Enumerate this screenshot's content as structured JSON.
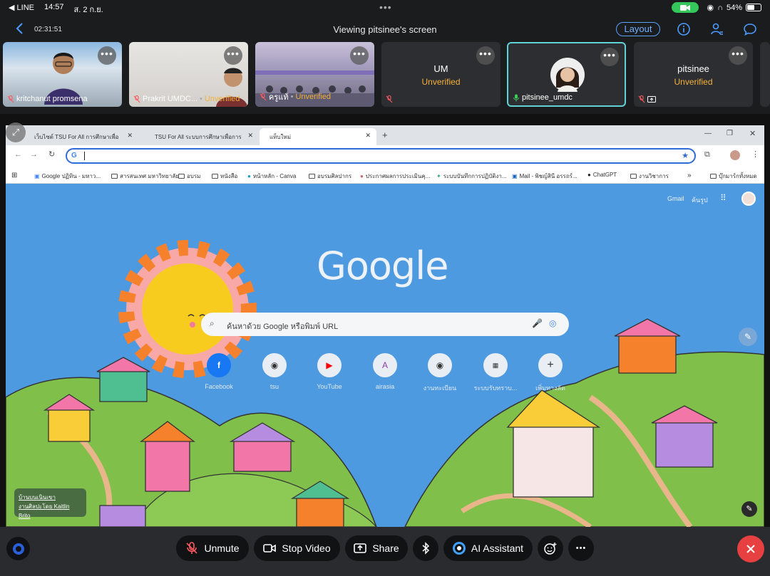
{
  "status": {
    "app": "◀ LINE",
    "time": "14:57",
    "date": "ส. 2 ก.ย.",
    "battery": "54%"
  },
  "meeting": {
    "timer": "02:31:51",
    "title": "Viewing pitsinee's screen",
    "layout_label": "Layout"
  },
  "participants": [
    {
      "name": "kritchanut promsena",
      "status": ""
    },
    {
      "name": "Prakrit UMDC...",
      "status": "Unverified"
    },
    {
      "name": "ครูแท้",
      "status": "Unverified"
    },
    {
      "name": "UM",
      "status": "Unverified"
    },
    {
      "name": "pitsinee_umdc",
      "status": ""
    },
    {
      "name": "pitsinee",
      "status": "Unverified"
    }
  ],
  "browser": {
    "tabs": [
      {
        "label": "เว็บไซต์ TSU For All การศึกษาเพื่อ"
      },
      {
        "label": "TSU For All ระบบการศึกษาเพื่อการ"
      },
      {
        "label": "แท็บใหม่"
      }
    ],
    "new_tab": "+",
    "bookmarks": [
      "Google ปฏิทิน - มหาว...",
      "สารสนเทศ มหาวิทยาลัย",
      "อบรม",
      "หนังสือ",
      "หน้าหลัก - Canva",
      "อบรมศิลปากร",
      "ประกาศผลการประเมินคุ...",
      "ระบบบันทึกการปฏิบัติงา...",
      "Mail - พิชญ์สินี อรรถร์...",
      "ChatGPT",
      "งานวิชาการ",
      "บุ๊กมาร์กทั้งหมด"
    ],
    "overflow": "»"
  },
  "google": {
    "logo": "Google",
    "gmail": "Gmail",
    "images": "ค้นรูป",
    "search_placeholder": "ค้นหาด้วย Google หรือพิมพ์ URL",
    "shortcuts": [
      {
        "label": "Facebook",
        "icon": "f"
      },
      {
        "label": "tsu",
        "icon": ""
      },
      {
        "label": "YouTube",
        "icon": "▶"
      },
      {
        "label": "airasia",
        "icon": "A"
      },
      {
        "label": "งานทะเบียน",
        "icon": ""
      },
      {
        "label": "ระบบรับทราบ...",
        "icon": ""
      },
      {
        "label": "เพิ่มทางลัด",
        "icon": "+"
      }
    ],
    "credit_title": "บ้านบนเนินเขา",
    "credit_author": "งานศิลปะโดย Kaitlin Brito"
  },
  "controls": {
    "unmute": "Unmute",
    "stop_video": "Stop Video",
    "share": "Share",
    "ai_assistant": "AI Assistant",
    "more": "•••"
  }
}
